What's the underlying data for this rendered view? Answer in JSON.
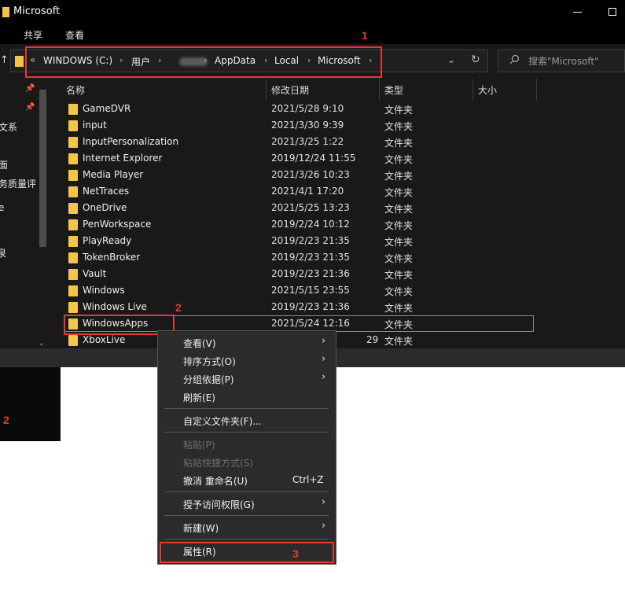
{
  "window": {
    "title": "Microsoft"
  },
  "ribbon": {
    "tabs": [
      "共享",
      "查看"
    ]
  },
  "address": {
    "prefix": "«",
    "crumbs": [
      "WINDOWS (C:)",
      "用户",
      "",
      "AppData",
      "Local",
      "Microsoft"
    ],
    "separator": "›"
  },
  "search": {
    "placeholder": "搜索\"Microsoft\""
  },
  "nav_pane": {
    "items": [
      "文系",
      "面",
      "务质量评",
      "e",
      "泉"
    ]
  },
  "columns": {
    "name": "名称",
    "date": "修改日期",
    "type": "类型",
    "size": "大小"
  },
  "files": [
    {
      "name": "GameDVR",
      "date": "2021/5/28 9:10",
      "type": "文件夹"
    },
    {
      "name": "input",
      "date": "2021/3/30 9:39",
      "type": "文件夹"
    },
    {
      "name": "InputPersonalization",
      "date": "2021/3/25 1:22",
      "type": "文件夹"
    },
    {
      "name": "Internet Explorer",
      "date": "2019/12/24 11:55",
      "type": "文件夹"
    },
    {
      "name": "Media Player",
      "date": "2021/3/26 10:23",
      "type": "文件夹"
    },
    {
      "name": "NetTraces",
      "date": "2021/4/1 17:20",
      "type": "文件夹"
    },
    {
      "name": "OneDrive",
      "date": "2021/5/25 13:23",
      "type": "文件夹"
    },
    {
      "name": "PenWorkspace",
      "date": "2019/2/24 10:12",
      "type": "文件夹"
    },
    {
      "name": "PlayReady",
      "date": "2019/2/23 21:35",
      "type": "文件夹"
    },
    {
      "name": "TokenBroker",
      "date": "2019/2/23 21:35",
      "type": "文件夹"
    },
    {
      "name": "Vault",
      "date": "2019/2/23 21:36",
      "type": "文件夹"
    },
    {
      "name": "Windows",
      "date": "2021/5/15 23:55",
      "type": "文件夹"
    },
    {
      "name": "Windows Live",
      "date": "2019/2/23 21:36",
      "type": "文件夹"
    },
    {
      "name": "WindowsApps",
      "date": "2021/5/24 12:16",
      "type": "文件夹"
    },
    {
      "name": "XboxLive",
      "date": "29",
      "type": "文件夹"
    }
  ],
  "context_menu": {
    "view": "查看(V)",
    "sort": "排序方式(O)",
    "group": "分组依据(P)",
    "refresh": "刷新(E)",
    "customize": "自定义文件夹(F)...",
    "paste": "粘贴(P)",
    "paste_shortcut": "粘贴快捷方式(S)",
    "undo": "撤消 重命名(U)",
    "undo_shortcut": "Ctrl+Z",
    "give_access": "授予访问权限(G)",
    "new": "新建(W)",
    "properties": "属性(R)"
  },
  "annotations": [
    "1",
    "2",
    "2",
    "3"
  ],
  "colors": {
    "folder": "#f3c64a",
    "annotation": "#e53935",
    "menu_bg": "#2b2b2b",
    "window_bg": "#191919"
  }
}
